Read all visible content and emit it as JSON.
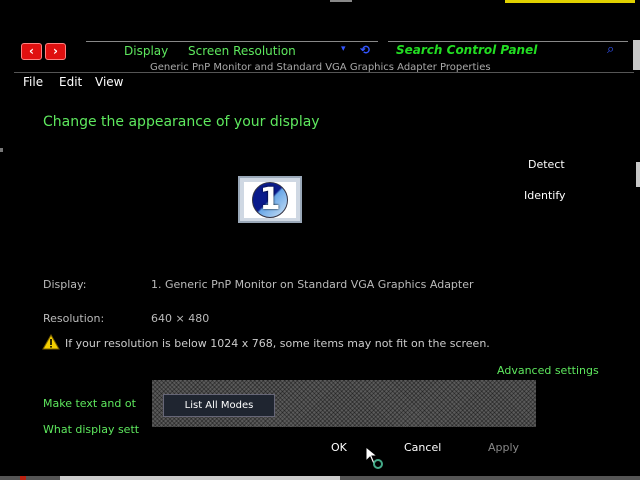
{
  "nav": {
    "back_icon": "chevron-left-icon",
    "forward_icon": "chevron-right-icon"
  },
  "breadcrumb": {
    "item1": "Display",
    "item2": "Screen Resolution"
  },
  "search": {
    "placeholder": "Search Control Panel"
  },
  "window": {
    "title": "Generic PnP Monitor and Standard VGA Graphics Adapter Properties"
  },
  "menu": {
    "file": "File",
    "edit": "Edit",
    "view": "View"
  },
  "main": {
    "heading": "Change the appearance of your display",
    "detect": "Detect",
    "identify": "Identify",
    "monitor_number": "1",
    "display_label": "Display:",
    "display_value": "1. Generic PnP Monitor on Standard VGA Graphics Adapter",
    "resolution_label": "Resolution:",
    "resolution_value": "640 × 480",
    "warning": "If your resolution is below 1024 x 768, some items may not fit on the screen.",
    "advanced": "Advanced settings",
    "link_text_size": "Make text and ot",
    "link_display_settings": "What display sett"
  },
  "overlay": {
    "list_modes": "List All Modes"
  },
  "buttons": {
    "ok": "OK",
    "cancel": "Cancel",
    "apply": "Apply"
  },
  "colors": {
    "accent_link": "#5ee85e",
    "nav_red": "#e01010",
    "search_green": "#22dd22"
  }
}
